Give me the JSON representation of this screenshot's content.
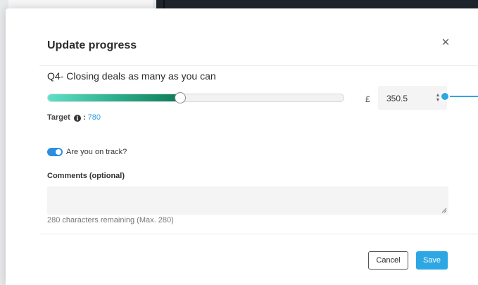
{
  "modal": {
    "title": "Update progress",
    "close_icon": "close-icon",
    "goal_name": "Q4- Closing deals as many as you can",
    "progress": {
      "fraction": 0.449,
      "currency_symbol": "£",
      "value": "350.5"
    },
    "target": {
      "label": "Target",
      "separator": ":",
      "value": "780"
    },
    "on_track": {
      "checked": true,
      "label": "Are you on track?"
    },
    "comments": {
      "label": "Comments (optional)",
      "value": "",
      "remaining": "280 characters remaining (Max. 280)"
    },
    "buttons": {
      "cancel": "Cancel",
      "save": "Save"
    }
  },
  "colors": {
    "accent": "#2da7e3",
    "progress_start": "#5fe0c6",
    "progress_end": "#0d7a56",
    "toggle_on": "#2d8ee0"
  }
}
